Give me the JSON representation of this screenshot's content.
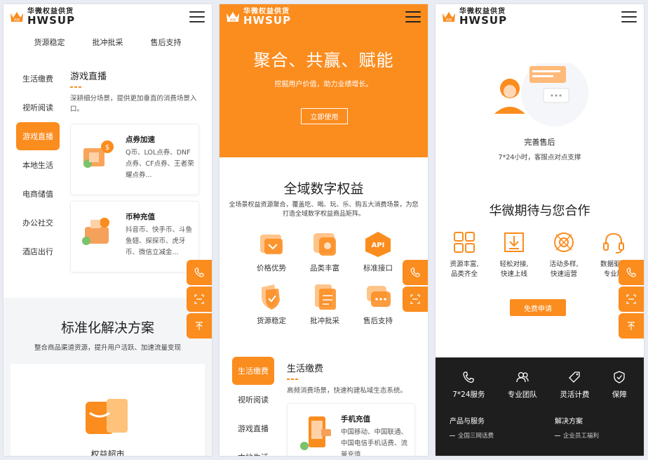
{
  "brand": {
    "cn": "华微权益供货",
    "en": "HWSUP",
    "mark": "HW",
    "accent": "#fb8c1e",
    "dark": "#1e1e1e"
  },
  "panel1": {
    "sublinks": [
      "货源稳定",
      "批冲批采",
      "售后支持"
    ],
    "tabs": [
      "生活缴费",
      "视听阅读",
      "游戏直播",
      "本地生活",
      "电商储值",
      "办公社交",
      "酒店出行"
    ],
    "active_tab": "游戏直播",
    "section": {
      "title": "游戏直播",
      "desc": "深耕细分场景，提供更加垂直的消费场景入口。"
    },
    "cards": [
      {
        "title": "点券加速",
        "desc": "Q币、LOL点券、DNF点券、CF点券、王者荣耀点券..."
      },
      {
        "title": "币种充值",
        "desc": "抖音币、快手币、斗鱼鱼翅、探探币、虎牙币、微信立减金..."
      }
    ],
    "solution": {
      "title": "标准化解决方案",
      "sub": "整合商品渠道资源，提升用户活跃、加速流量变现",
      "item": "权益超市"
    }
  },
  "panel2": {
    "hero": {
      "title": "聚合、共赢、赋能",
      "sub": "挖掘用户价值，助力业绩增长。",
      "button": "立即使用"
    },
    "section": {
      "title": "全域数字权益",
      "sub": "全场景权益资源聚合，覆盖吃、喝、玩、乐、购五大消费场景，为您打造全域数字权益商品矩阵。"
    },
    "features": [
      "价格优势",
      "品类丰富",
      "标准接口",
      "货源稳定",
      "批冲批采",
      "售后支持"
    ],
    "api_text": "API",
    "tabs": [
      "生活缴费",
      "视听阅读",
      "游戏直播",
      "本地生活"
    ],
    "active_tab": "生活缴费",
    "life": {
      "title": "生活缴费",
      "desc": "高频消费场景，快速构建私域生态系统。"
    },
    "card": {
      "title": "手机充值",
      "desc": "中国移动、中国联通、中国电信手机话费、流量充值"
    }
  },
  "panel3": {
    "service": {
      "title": "完善售后",
      "desc": "7*24小时，客服点对点支撑"
    },
    "coop": {
      "title": "华微期待与您合作",
      "items": [
        {
          "l1": "资源丰富,",
          "l2": "品类齐全"
        },
        {
          "l1": "轻松对接,",
          "l2": "快速上线"
        },
        {
          "l1": "活动多样,",
          "l2": "快速运营"
        },
        {
          "l1": "数据驱动",
          "l2": "专业服"
        }
      ],
      "button": "免费申请"
    },
    "footer_icons": [
      "7*24服务",
      "专业团队",
      "灵活计费",
      "保障"
    ],
    "footer_cols": [
      {
        "head": "产品与服务",
        "links": [
          "全国三网话费"
        ]
      },
      {
        "head": "解决方案",
        "links": [
          "企业员工福利"
        ]
      }
    ]
  }
}
